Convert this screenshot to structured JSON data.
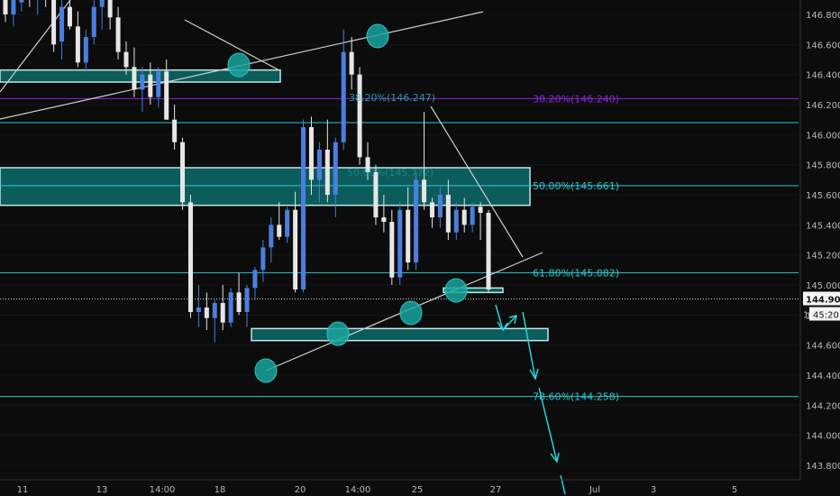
{
  "chart_data": {
    "type": "candlestick",
    "y_range": [
      143.7,
      147.0
    ],
    "y_ticks": [
      "146.800",
      "146.600",
      "146.400",
      "146.200",
      "146.000",
      "145.800",
      "145.600",
      "145.400",
      "145.200",
      "145.000",
      "144.800",
      "144.600",
      "144.400",
      "144.200",
      "144.000",
      "143.800"
    ],
    "x_ticks": [
      "11",
      "13",
      "14:00",
      "18",
      "20",
      "14:00",
      "25",
      "27",
      "Jul",
      "3",
      "5"
    ],
    "current_price": "144.907",
    "countdown": "45:20",
    "countdown_prefix": "1",
    "fib_levels": [
      {
        "label": "38.20%(146.240)",
        "value": 146.24,
        "color": "#8e24d8"
      },
      {
        "label": "50.00%(145.661)",
        "value": 145.661,
        "color": "#28c8d0"
      },
      {
        "label": "61.80%(145.082)",
        "value": 145.082,
        "color": "#28c8d0"
      },
      {
        "label": "78.60%(144.258)",
        "value": 144.258,
        "color": "#28c8d0"
      }
    ],
    "ghost_labels": [
      {
        "label": "38.20%(146.247)",
        "value": 146.247
      },
      {
        "label": "50.00%(145.772)",
        "value": 145.75
      }
    ],
    "horizontal_lines": [
      146.08
    ],
    "zones": [
      {
        "top": 146.43,
        "bottom": 146.35
      },
      {
        "top": 145.78,
        "bottom": 145.53
      },
      {
        "top": 144.98,
        "bottom": 144.95
      },
      {
        "top": 144.71,
        "bottom": 144.63
      }
    ],
    "candles": [
      [
        146.92,
        147.0,
        146.75,
        146.8
      ],
      [
        146.8,
        146.95,
        146.72,
        146.9
      ],
      [
        146.88,
        147.0,
        146.82,
        146.95
      ],
      [
        146.95,
        147.0,
        146.85,
        146.9
      ],
      [
        146.92,
        147.0,
        146.8,
        146.96
      ],
      [
        146.96,
        147.0,
        146.85,
        146.92
      ],
      [
        146.92,
        146.98,
        146.55,
        146.6
      ],
      [
        146.62,
        146.9,
        146.5,
        146.85
      ],
      [
        146.85,
        146.92,
        146.7,
        146.72
      ],
      [
        146.72,
        146.82,
        146.45,
        146.48
      ],
      [
        146.48,
        146.7,
        146.42,
        146.65
      ],
      [
        146.65,
        146.9,
        146.6,
        146.85
      ],
      [
        146.85,
        147.0,
        146.7,
        146.95
      ],
      [
        146.95,
        147.0,
        146.7,
        146.78
      ],
      [
        146.78,
        146.85,
        146.5,
        146.55
      ],
      [
        146.55,
        146.62,
        146.4,
        146.45
      ],
      [
        146.45,
        146.58,
        146.25,
        146.3
      ],
      [
        146.3,
        146.45,
        146.15,
        146.4
      ],
      [
        146.4,
        146.48,
        146.2,
        146.25
      ],
      [
        146.25,
        146.45,
        146.18,
        146.42
      ],
      [
        146.42,
        146.5,
        146.1,
        146.1
      ],
      [
        146.1,
        146.2,
        145.9,
        145.95
      ],
      [
        145.95,
        145.98,
        145.5,
        145.55
      ],
      [
        145.55,
        145.6,
        144.78,
        144.82
      ],
      [
        144.82,
        145.0,
        144.72,
        144.85
      ],
      [
        144.85,
        144.95,
        144.7,
        144.78
      ],
      [
        144.78,
        144.9,
        144.62,
        144.88
      ],
      [
        144.88,
        145.0,
        144.7,
        144.75
      ],
      [
        144.75,
        144.98,
        144.72,
        144.95
      ],
      [
        144.95,
        145.08,
        144.8,
        144.82
      ],
      [
        144.82,
        145.0,
        144.72,
        144.98
      ],
      [
        144.98,
        145.12,
        144.9,
        145.1
      ],
      [
        145.1,
        145.3,
        145.02,
        145.25
      ],
      [
        145.25,
        145.45,
        145.15,
        145.4
      ],
      [
        145.4,
        145.55,
        145.3,
        145.32
      ],
      [
        145.32,
        145.52,
        145.28,
        145.5
      ],
      [
        145.5,
        145.62,
        144.95,
        144.97
      ],
      [
        144.97,
        146.1,
        144.95,
        146.05
      ],
      [
        146.05,
        146.12,
        145.6,
        145.7
      ],
      [
        145.7,
        145.95,
        145.55,
        145.9
      ],
      [
        145.9,
        146.1,
        145.55,
        145.6
      ],
      [
        145.6,
        145.98,
        145.45,
        145.95
      ],
      [
        145.95,
        146.7,
        145.9,
        146.55
      ],
      [
        146.55,
        146.65,
        146.3,
        146.4
      ],
      [
        146.4,
        146.45,
        145.8,
        145.85
      ],
      [
        145.85,
        145.95,
        145.7,
        145.75
      ],
      [
        145.75,
        145.8,
        145.4,
        145.45
      ],
      [
        145.45,
        145.6,
        145.35,
        145.42
      ],
      [
        145.42,
        145.5,
        145.0,
        145.05
      ],
      [
        145.05,
        145.55,
        145.0,
        145.5
      ],
      [
        145.5,
        145.65,
        145.1,
        145.15
      ],
      [
        145.15,
        145.75,
        145.1,
        145.7
      ],
      [
        145.7,
        146.15,
        145.5,
        145.55
      ],
      [
        145.55,
        145.58,
        145.38,
        145.45
      ],
      [
        145.45,
        145.65,
        145.38,
        145.6
      ],
      [
        145.6,
        145.7,
        145.3,
        145.35
      ],
      [
        145.35,
        145.55,
        145.3,
        145.5
      ],
      [
        145.5,
        145.58,
        145.35,
        145.4
      ],
      [
        145.4,
        145.55,
        145.35,
        145.52
      ],
      [
        145.52,
        145.55,
        145.3,
        145.48
      ],
      [
        145.48,
        145.5,
        144.95,
        144.97
      ]
    ]
  }
}
